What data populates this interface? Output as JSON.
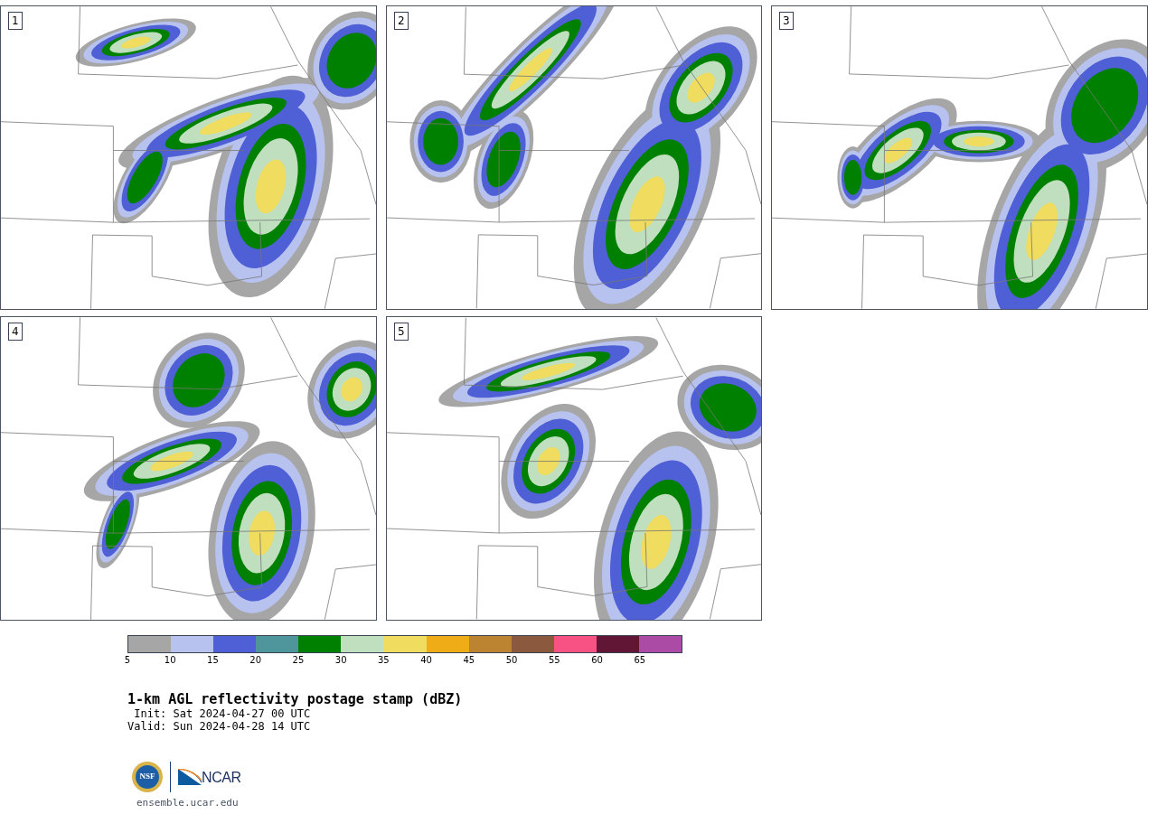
{
  "panels": [
    {
      "label": "1"
    },
    {
      "label": "2"
    },
    {
      "label": "3"
    },
    {
      "label": "4"
    },
    {
      "label": "5"
    }
  ],
  "colorbar": {
    "segments": [
      {
        "color": "#a6a6a6"
      },
      {
        "color": "#b8c2ef"
      },
      {
        "color": "#4f5fd5"
      },
      {
        "color": "#4e969b"
      },
      {
        "color": "#008000"
      },
      {
        "color": "#bfdfbf"
      },
      {
        "color": "#f0dc5e"
      },
      {
        "color": "#f0ac16"
      },
      {
        "color": "#bc8430"
      },
      {
        "color": "#8b5a3e"
      },
      {
        "color": "#f75283"
      },
      {
        "color": "#611635"
      },
      {
        "color": "#ab4ba5"
      }
    ],
    "ticks": [
      "5",
      "10",
      "15",
      "20",
      "25",
      "30",
      "35",
      "40",
      "45",
      "50",
      "55",
      "60",
      "65"
    ]
  },
  "title": "1-km AGL reflectivity postage stamp (dBZ)",
  "init": " Init: Sat 2024-04-27 00 UTC",
  "valid": "Valid: Sun 2024-04-28 14 UTC",
  "logos": {
    "nsf": "NSF",
    "ncar": "NCAR"
  },
  "site": "ensemble.ucar.edu"
}
